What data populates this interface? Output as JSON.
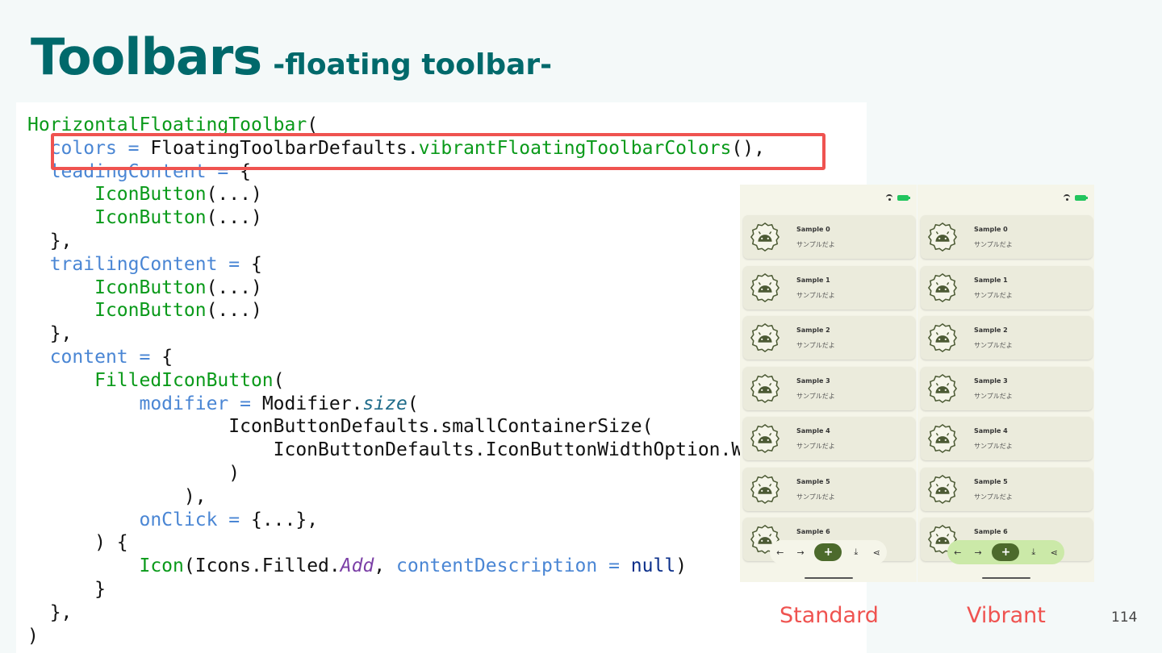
{
  "slide": {
    "title_main": "Toolbars",
    "title_sub": "-floating toolbar-",
    "page_number": "114",
    "caption_standard": "Standard",
    "caption_vibrant": "Vibrant"
  },
  "code_lines": [
    [
      {
        "t": "HorizontalFloatingToolbar",
        "c": "fn"
      },
      {
        "t": "(",
        "c": "pl"
      }
    ],
    [
      {
        "t": "  ",
        "c": "pl"
      },
      {
        "t": "colors",
        "c": "pr"
      },
      {
        "t": " = ",
        "c": "pr"
      },
      {
        "t": "FloatingToolbarDefaults.",
        "c": "pl"
      },
      {
        "t": "vibrantFloatingToolbarColors",
        "c": "fn"
      },
      {
        "t": "(),",
        "c": "pl"
      }
    ],
    [
      {
        "t": "  ",
        "c": "pl"
      },
      {
        "t": "leadingContent",
        "c": "pr"
      },
      {
        "t": " = ",
        "c": "pr"
      },
      {
        "t": "{",
        "c": "pl"
      }
    ],
    [
      {
        "t": "      ",
        "c": "pl"
      },
      {
        "t": "IconButton",
        "c": "fn"
      },
      {
        "t": "(...)",
        "c": "pl"
      }
    ],
    [
      {
        "t": "      ",
        "c": "pl"
      },
      {
        "t": "IconButton",
        "c": "fn"
      },
      {
        "t": "(...)",
        "c": "pl"
      }
    ],
    [
      {
        "t": "  },",
        "c": "pl"
      }
    ],
    [
      {
        "t": "  ",
        "c": "pl"
      },
      {
        "t": "trailingContent",
        "c": "pr"
      },
      {
        "t": " = ",
        "c": "pr"
      },
      {
        "t": "{",
        "c": "pl"
      }
    ],
    [
      {
        "t": "      ",
        "c": "pl"
      },
      {
        "t": "IconButton",
        "c": "fn"
      },
      {
        "t": "(...)",
        "c": "pl"
      }
    ],
    [
      {
        "t": "      ",
        "c": "pl"
      },
      {
        "t": "IconButton",
        "c": "fn"
      },
      {
        "t": "(...)",
        "c": "pl"
      }
    ],
    [
      {
        "t": "  },",
        "c": "pl"
      }
    ],
    [
      {
        "t": "  ",
        "c": "pl"
      },
      {
        "t": "content",
        "c": "pr"
      },
      {
        "t": " = ",
        "c": "pr"
      },
      {
        "t": "{",
        "c": "pl"
      }
    ],
    [
      {
        "t": "      ",
        "c": "pl"
      },
      {
        "t": "FilledIconButton",
        "c": "fn"
      },
      {
        "t": "(",
        "c": "pl"
      }
    ],
    [
      {
        "t": "          ",
        "c": "pl"
      },
      {
        "t": "modifier",
        "c": "pr"
      },
      {
        "t": " = ",
        "c": "pr"
      },
      {
        "t": "Modifier.",
        "c": "pl"
      },
      {
        "t": "size",
        "c": "sz"
      },
      {
        "t": "(",
        "c": "pl"
      }
    ],
    [
      {
        "t": "                  IconButtonDefaults.smallContainerSize(",
        "c": "pl"
      }
    ],
    [
      {
        "t": "                      IconButtonDefaults.IconButtonWidthOption.Wide",
        "c": "pl"
      }
    ],
    [
      {
        "t": "                  )",
        "c": "pl"
      }
    ],
    [
      {
        "t": "              ),",
        "c": "pl"
      }
    ],
    [
      {
        "t": "          ",
        "c": "pl"
      },
      {
        "t": "onClick",
        "c": "pr"
      },
      {
        "t": " = ",
        "c": "pr"
      },
      {
        "t": "{...},",
        "c": "pl"
      }
    ],
    [
      {
        "t": "      ) {",
        "c": "pl"
      }
    ],
    [
      {
        "t": "          ",
        "c": "pl"
      },
      {
        "t": "Icon",
        "c": "fn"
      },
      {
        "t": "(Icons.Filled.",
        "c": "pl"
      },
      {
        "t": "Add",
        "c": "it"
      },
      {
        "t": ", ",
        "c": "pl"
      },
      {
        "t": "contentDescription",
        "c": "pr"
      },
      {
        "t": " = ",
        "c": "pr"
      },
      {
        "t": "null",
        "c": "kw"
      },
      {
        "t": ")",
        "c": "pl"
      }
    ],
    [
      {
        "t": "      }",
        "c": "pl"
      }
    ],
    [
      {
        "t": "  },",
        "c": "pl"
      }
    ],
    [
      {
        "t": ")",
        "c": "pl"
      }
    ]
  ],
  "code_colors": {
    "fn": "#0a9a1a",
    "pr": "#4a86d4",
    "pl": "#111111",
    "it": "#7b3fa6",
    "sz": "#1e6b8a",
    "kw": "#0b2f8a"
  },
  "sample_list": [
    {
      "title": "Sample 0",
      "subtitle": "サンプルだよ"
    },
    {
      "title": "Sample 1",
      "subtitle": "サンプルだよ"
    },
    {
      "title": "Sample 2",
      "subtitle": "サンプルだよ"
    },
    {
      "title": "Sample 3",
      "subtitle": "サンプルだよ"
    },
    {
      "title": "Sample 4",
      "subtitle": "サンプルだよ"
    },
    {
      "title": "Sample 5",
      "subtitle": "サンプルだよ"
    },
    {
      "title": "Sample 6",
      "subtitle": ""
    }
  ],
  "toolbar_buttons": [
    {
      "icon": "arrow-back-icon",
      "glyph": "←"
    },
    {
      "icon": "arrow-forward-icon",
      "glyph": "→"
    },
    {
      "icon": "add-icon",
      "glyph": "+"
    },
    {
      "icon": "download-icon",
      "glyph": "⤓"
    },
    {
      "icon": "share-icon",
      "glyph": "⋖"
    }
  ],
  "colors": {
    "title": "#00696b",
    "highlight": "#ef5350",
    "standard_toolbar": "#f5f5e9",
    "vibrant_toolbar": "#cbe9a8",
    "add_button": "#4c6a2c"
  }
}
